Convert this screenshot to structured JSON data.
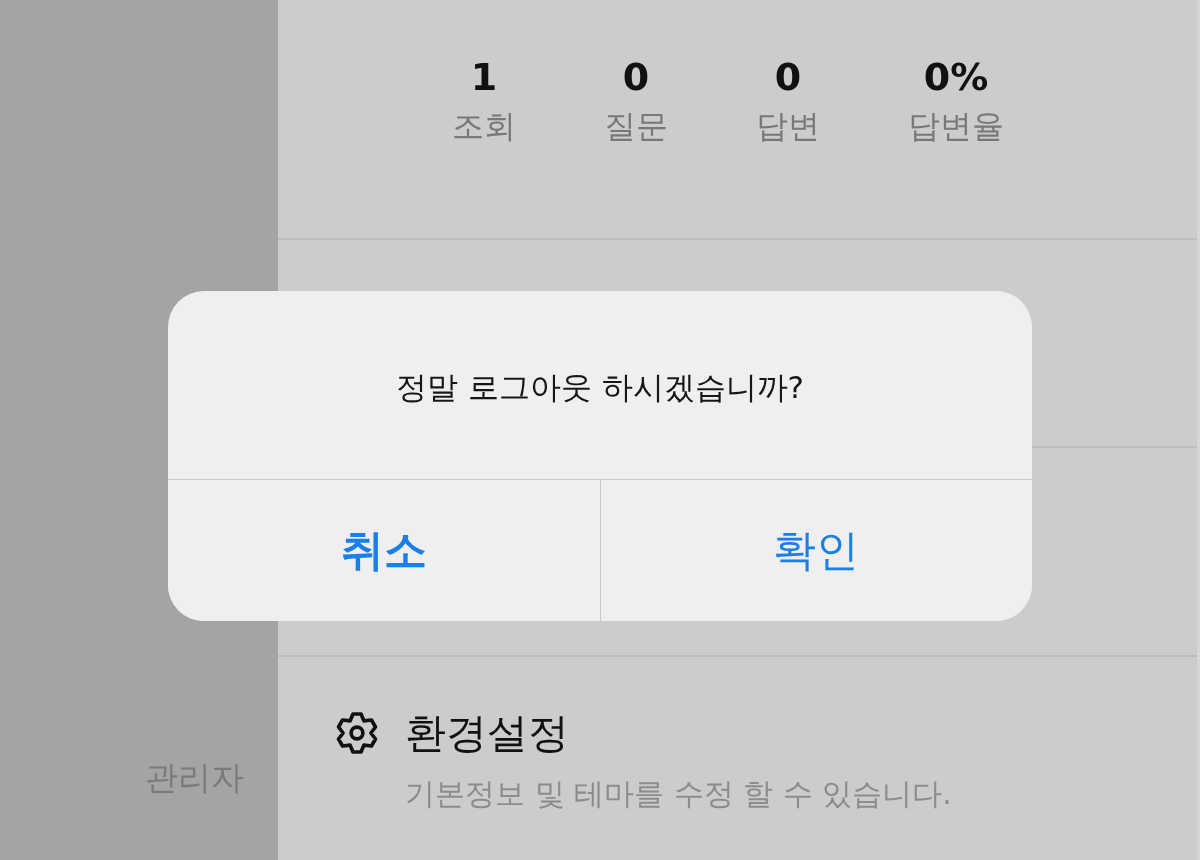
{
  "sidebar": {
    "text": "관리자"
  },
  "stats": [
    {
      "value": "1",
      "label": "조회"
    },
    {
      "value": "0",
      "label": "질문"
    },
    {
      "value": "0",
      "label": "답변"
    },
    {
      "value": "0%",
      "label": "답변율"
    }
  ],
  "settings_item": {
    "title": "환경설정",
    "description": "기본정보 및 테마를 수정 할 수 있습니다."
  },
  "alert": {
    "message": "정말 로그아웃 하시겠습니까?",
    "buttons": [
      {
        "label": "취소",
        "kind": "cancel"
      },
      {
        "label": "확인",
        "kind": "default"
      }
    ]
  }
}
